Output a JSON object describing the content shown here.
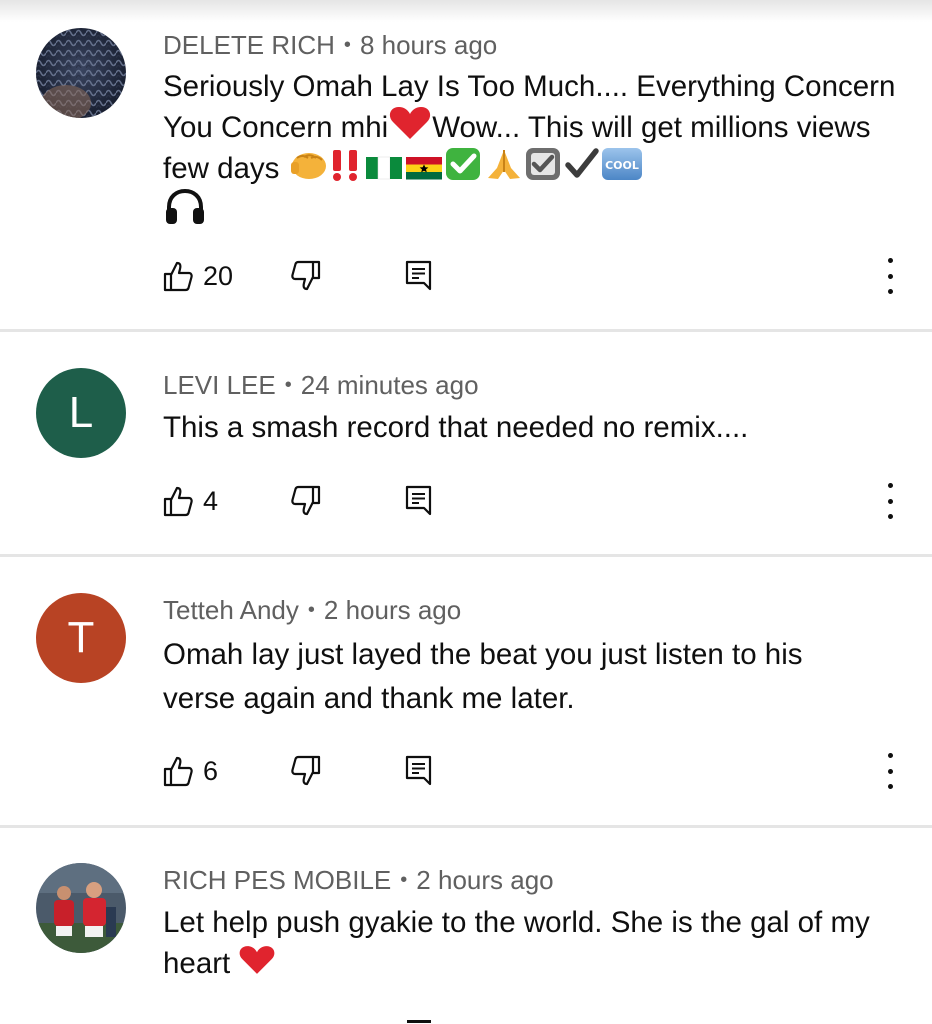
{
  "comments": [
    {
      "author": "DELETE RICH",
      "time": "8 hours ago",
      "text_a": "Seriously Omah Lay Is Too Much.... Everything Concern You Concern mhi",
      "text_b": "Wow... This will get millions views few days ",
      "likes": "20",
      "avatar_icon": "woven-texture-avatar"
    },
    {
      "author": "LEVI LEE",
      "time": "24 minutes ago",
      "text": "This a smash record that needed no remix....",
      "likes": "4",
      "avatar_letter": "L",
      "avatar_color": "#1e5e4a"
    },
    {
      "author": "Tetteh Andy",
      "time": "2 hours ago",
      "text": "Omah lay just layed the beat you just listen to his verse again and thank me later.",
      "likes": "6",
      "avatar_letter": "T",
      "avatar_color": "#b84324"
    },
    {
      "author": "RICH PES MOBILE",
      "time": "2 hours ago",
      "text": "Let help push gyakie to the world.  She is the gal of my heart ",
      "avatar_icon": "football-players-avatar"
    }
  ],
  "emoji": {
    "cool_label": "COOL"
  },
  "icons": {
    "like": "thumbs-up-icon",
    "dislike": "thumbs-down-icon",
    "reply": "reply-comment-icon",
    "menu": "more-vertical-icon"
  }
}
